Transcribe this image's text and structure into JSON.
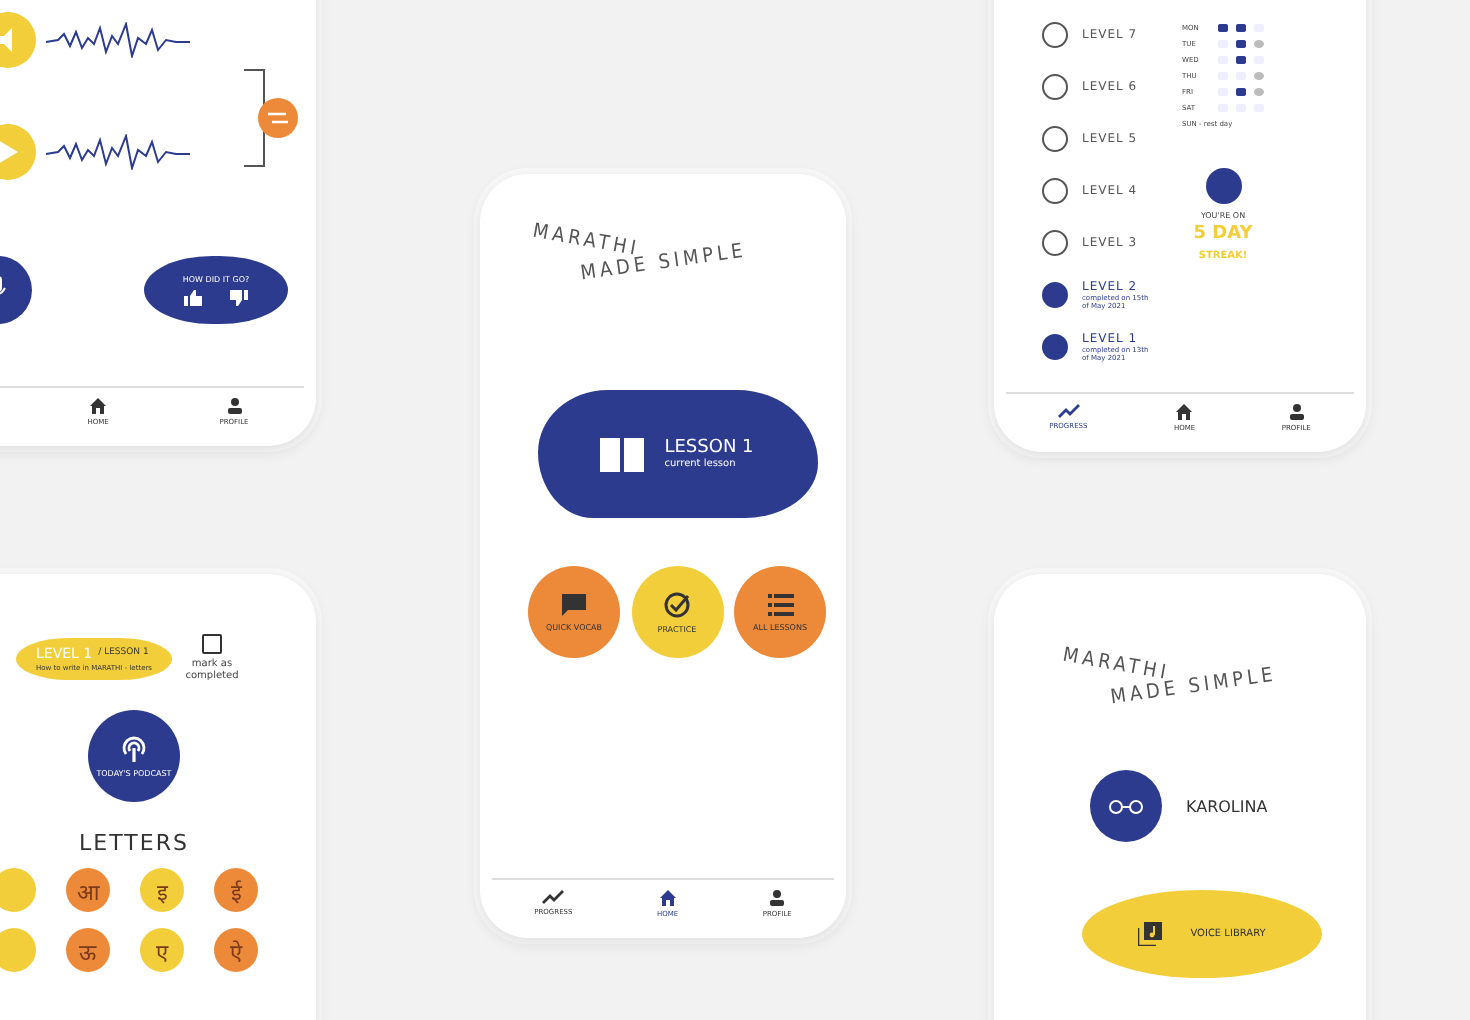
{
  "phones": [
    {
      "kind": "recording",
      "feedback": {
        "label": "HOW DID IT GO?"
      },
      "nav": [
        {
          "label": "HOME",
          "kind": "home",
          "selected": false
        },
        {
          "label": "PROFILE",
          "kind": "profile",
          "selected": false
        }
      ]
    },
    {
      "kind": "home",
      "title": [
        "MARATHI",
        "MADE SIMPLE"
      ],
      "lesson": {
        "title": "LESSON 1",
        "subtitle": "current lesson"
      },
      "actions": [
        {
          "label": "QUICK VOCAB",
          "kind": "chat",
          "color": "#ec8a3a"
        },
        {
          "label": "PRACTICE",
          "kind": "check",
          "color": "#f2cf3a"
        },
        {
          "label": "ALL LESSONS",
          "kind": "list",
          "color": "#ec8a3a"
        }
      ],
      "nav": [
        {
          "label": "PROGRESS",
          "kind": "progress",
          "selected": false
        },
        {
          "label": "HOME",
          "kind": "home",
          "selected": true
        },
        {
          "label": "PROFILE",
          "kind": "profile",
          "selected": false
        }
      ]
    },
    {
      "kind": "levels",
      "levels": [
        {
          "label": "LEVEL 7",
          "done": false
        },
        {
          "label": "LEVEL 6",
          "done": false
        },
        {
          "label": "LEVEL 5",
          "done": false
        },
        {
          "label": "LEVEL 4",
          "done": false
        },
        {
          "label": "LEVEL 3",
          "done": false
        },
        {
          "label": "LEVEL 2",
          "done": true,
          "note": "completed on 15th of May 2021"
        },
        {
          "label": "LEVEL 1",
          "done": true,
          "note": "completed on 13th of May 2021"
        }
      ],
      "week": [
        {
          "day": "MON",
          "cells": [
            {
              "kind": "fill"
            },
            {
              "kind": "fill"
            },
            {
              "kind": "none"
            }
          ]
        },
        {
          "day": "TUE",
          "cells": [
            {
              "kind": "none"
            },
            {
              "kind": "fill"
            },
            {
              "kind": "ring"
            }
          ]
        },
        {
          "day": "WED",
          "cells": [
            {
              "kind": "none"
            },
            {
              "kind": "fill"
            },
            {
              "kind": "none"
            }
          ]
        },
        {
          "day": "THU",
          "cells": [
            {
              "kind": "none"
            },
            {
              "kind": "none"
            },
            {
              "kind": "ring"
            }
          ]
        },
        {
          "day": "FRI",
          "cells": [
            {
              "kind": "none"
            },
            {
              "kind": "fill"
            },
            {
              "kind": "ring"
            }
          ]
        },
        {
          "day": "SAT",
          "cells": [
            {
              "kind": "none"
            },
            {
              "kind": "none"
            },
            {
              "kind": "none"
            }
          ]
        }
      ],
      "rest": "SUN - rest day",
      "streak": {
        "caption": "YOU'RE ON",
        "count": "5 DAY",
        "word": "STREAK!"
      },
      "nav": [
        {
          "label": "PROGRESS",
          "kind": "progress",
          "selected": true
        },
        {
          "label": "HOME",
          "kind": "home",
          "selected": false
        },
        {
          "label": "PROFILE",
          "kind": "profile",
          "selected": false
        }
      ]
    },
    {
      "kind": "lesson",
      "level": "LEVEL 1",
      "lesson": "/ LESSON 1",
      "subtitle": "How to write in MARATHI - letters",
      "mark": {
        "label": "mark as completed",
        "checked": false
      },
      "podcast": "TODAY'S PODCAST",
      "section": "LETTERS",
      "letters": [
        {
          "char": "आ",
          "color": "#ec8a3a"
        },
        {
          "char": "इ",
          "color": "#f2cf3a"
        },
        {
          "char": "ई",
          "color": "#ec8a3a"
        },
        {
          "char": "ऊ",
          "color": "#ec8a3a"
        },
        {
          "char": "ए",
          "color": "#f2cf3a"
        },
        {
          "char": "ऐ",
          "color": "#ec8a3a"
        }
      ]
    },
    {
      "kind": "profile",
      "title": [
        "MARATHI",
        "MADE SIMPLE"
      ],
      "name": "KAROLINA",
      "library": "VOICE LIBRARY"
    }
  ]
}
